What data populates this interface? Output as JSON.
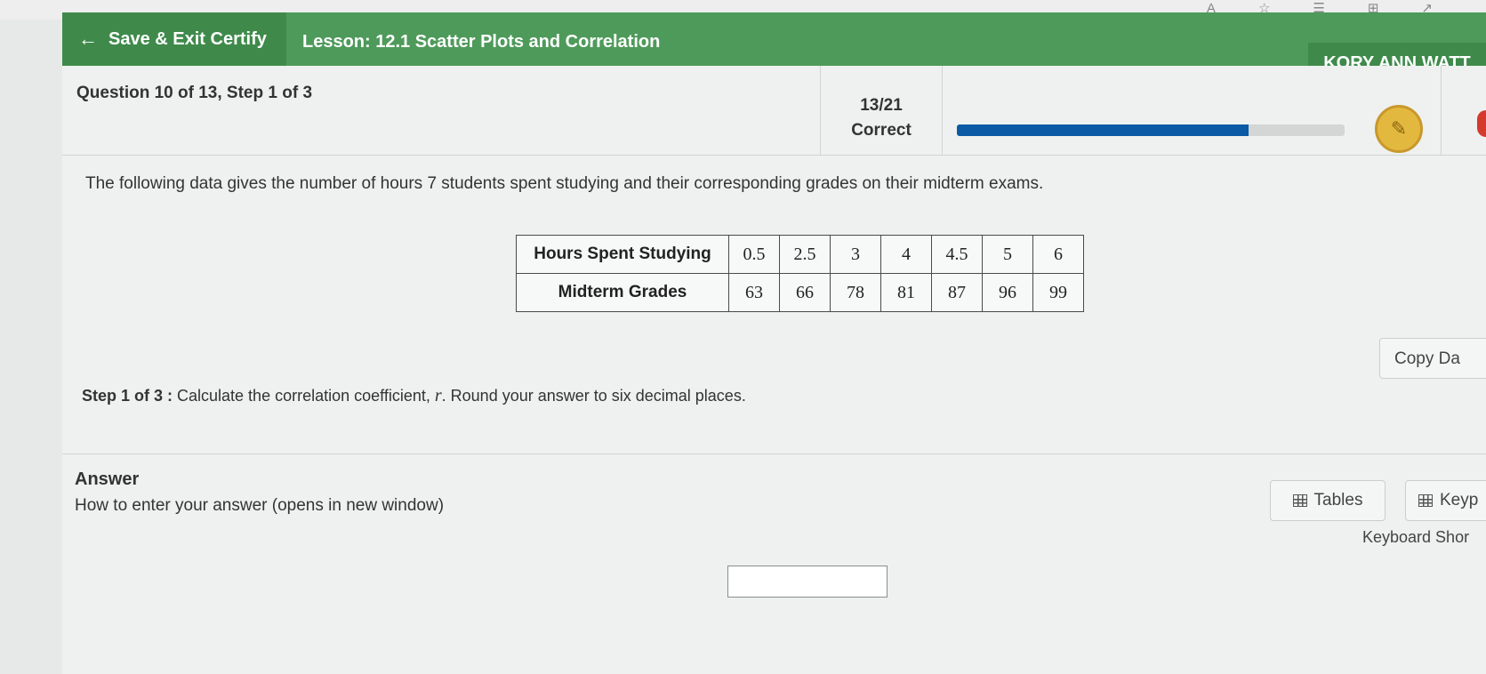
{
  "browser": {
    "icons": [
      "A",
      "☆",
      "☰",
      "⊞",
      "↗"
    ]
  },
  "header": {
    "save_exit": "Save & Exit Certify",
    "lesson": "Lesson: 12.1 Scatter Plots and Correlation",
    "user": "KORY ANN WATT"
  },
  "question": {
    "title": "Question 10 of 13, Step 1 of 3",
    "score": "13/21",
    "score_label": "Correct",
    "progress_fraction": 0.7523
  },
  "prompt": "The following data gives the number of hours 7 students spent studying and their corresponding grades on their midterm exams.",
  "table": {
    "row1_label": "Hours Spent Studying",
    "row1": [
      "0.5",
      "2.5",
      "3",
      "4",
      "4.5",
      "5",
      "6"
    ],
    "row2_label": "Midterm Grades",
    "row2": [
      "63",
      "66",
      "78",
      "81",
      "87",
      "96",
      "99"
    ]
  },
  "copy_data": "Copy Da",
  "step": {
    "label": "Step 1 of 3 :",
    "text_before": " Calculate the correlation coefficient, ",
    "var": "r",
    "text_after": ". Round your answer to six decimal places."
  },
  "answer": {
    "label": "Answer",
    "howto": "How to enter your answer (opens in new window)",
    "tables_btn": "Tables",
    "keypad_btn": "Keyp",
    "keyboard_shortcuts": "Keyboard Shor",
    "value": ""
  },
  "colors": {
    "header_green": "#4e9a5a",
    "header_dark_green": "#3f8a4b",
    "progress_blue": "#0b5aa6",
    "badge_gold": "#e3b83f"
  }
}
